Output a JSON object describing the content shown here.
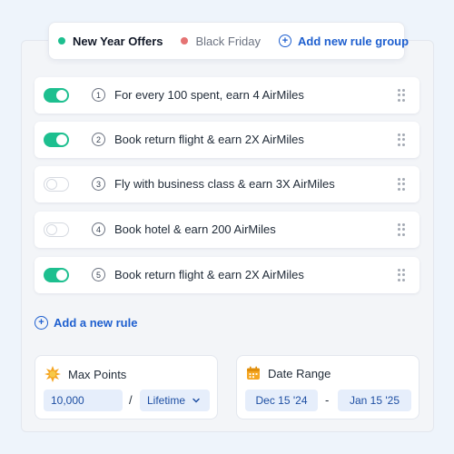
{
  "tabs": [
    {
      "label": "New Year Offers",
      "active": true,
      "dot_color": "#1dbf8f"
    },
    {
      "label": "Black Friday",
      "active": false,
      "dot_color": "#e57373"
    }
  ],
  "add_group_label": "Add new rule group",
  "rules": [
    {
      "number": "1",
      "text": "For every 100 spent, earn 4 AirMiles",
      "enabled": true
    },
    {
      "number": "2",
      "text": "Book return flight & earn 2X AirMiles",
      "enabled": true
    },
    {
      "number": "3",
      "text": "Fly with business class & earn 3X AirMiles",
      "enabled": false
    },
    {
      "number": "4",
      "text": "Book hotel & earn 200 AirMiles",
      "enabled": false
    },
    {
      "number": "5",
      "text": "Book return flight & earn 2X AirMiles",
      "enabled": true
    }
  ],
  "add_rule_label": "Add a new rule",
  "max_points": {
    "title": "Max Points",
    "value": "10,000",
    "separator": "/",
    "period": "Lifetime"
  },
  "date_range": {
    "title": "Date Range",
    "start": "Dec 15 '24",
    "separator": "-",
    "end": "Jan 15 '25"
  },
  "colors": {
    "accent": "#1e5fcf",
    "toggle_on": "#1dbf8f",
    "field_bg": "#e6eefb"
  }
}
